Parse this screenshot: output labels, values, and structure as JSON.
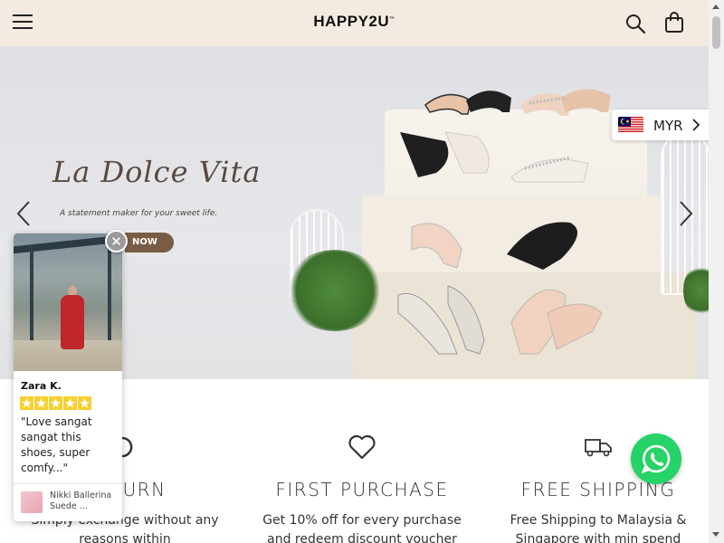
{
  "header": {
    "logo": "HAPPY2U",
    "logo_mark": "™"
  },
  "hero": {
    "script_title": "La Dolce Vita",
    "tagline": "A statement maker for your sweet life.",
    "cta": "NOW"
  },
  "currency": {
    "code": "MYR",
    "flag": "malaysia-flag"
  },
  "features": [
    {
      "icon": "refresh-icon",
      "title": "RETURN",
      "desc": "Simply exchange without any reasons within"
    },
    {
      "icon": "heart-icon",
      "title": "FIRST PURCHASE",
      "desc": "Get 10% off for every purchase and redeem discount voucher"
    },
    {
      "icon": "truck-icon",
      "title": "FREE SHIPPING",
      "desc": "Free Shipping to Malaysia & Singapore with min spend"
    }
  ],
  "review": {
    "name": "Zara K.",
    "rating": 5,
    "text": "\"Love sangat sangat this shoes, super comfy...\"",
    "product": "Nikki Ballerina Suede ..."
  },
  "colors": {
    "header_bg": "#f3ebe1",
    "star": "#f6d02f",
    "whatsapp": "#25d366",
    "cta_bg": "#7a5c45"
  }
}
